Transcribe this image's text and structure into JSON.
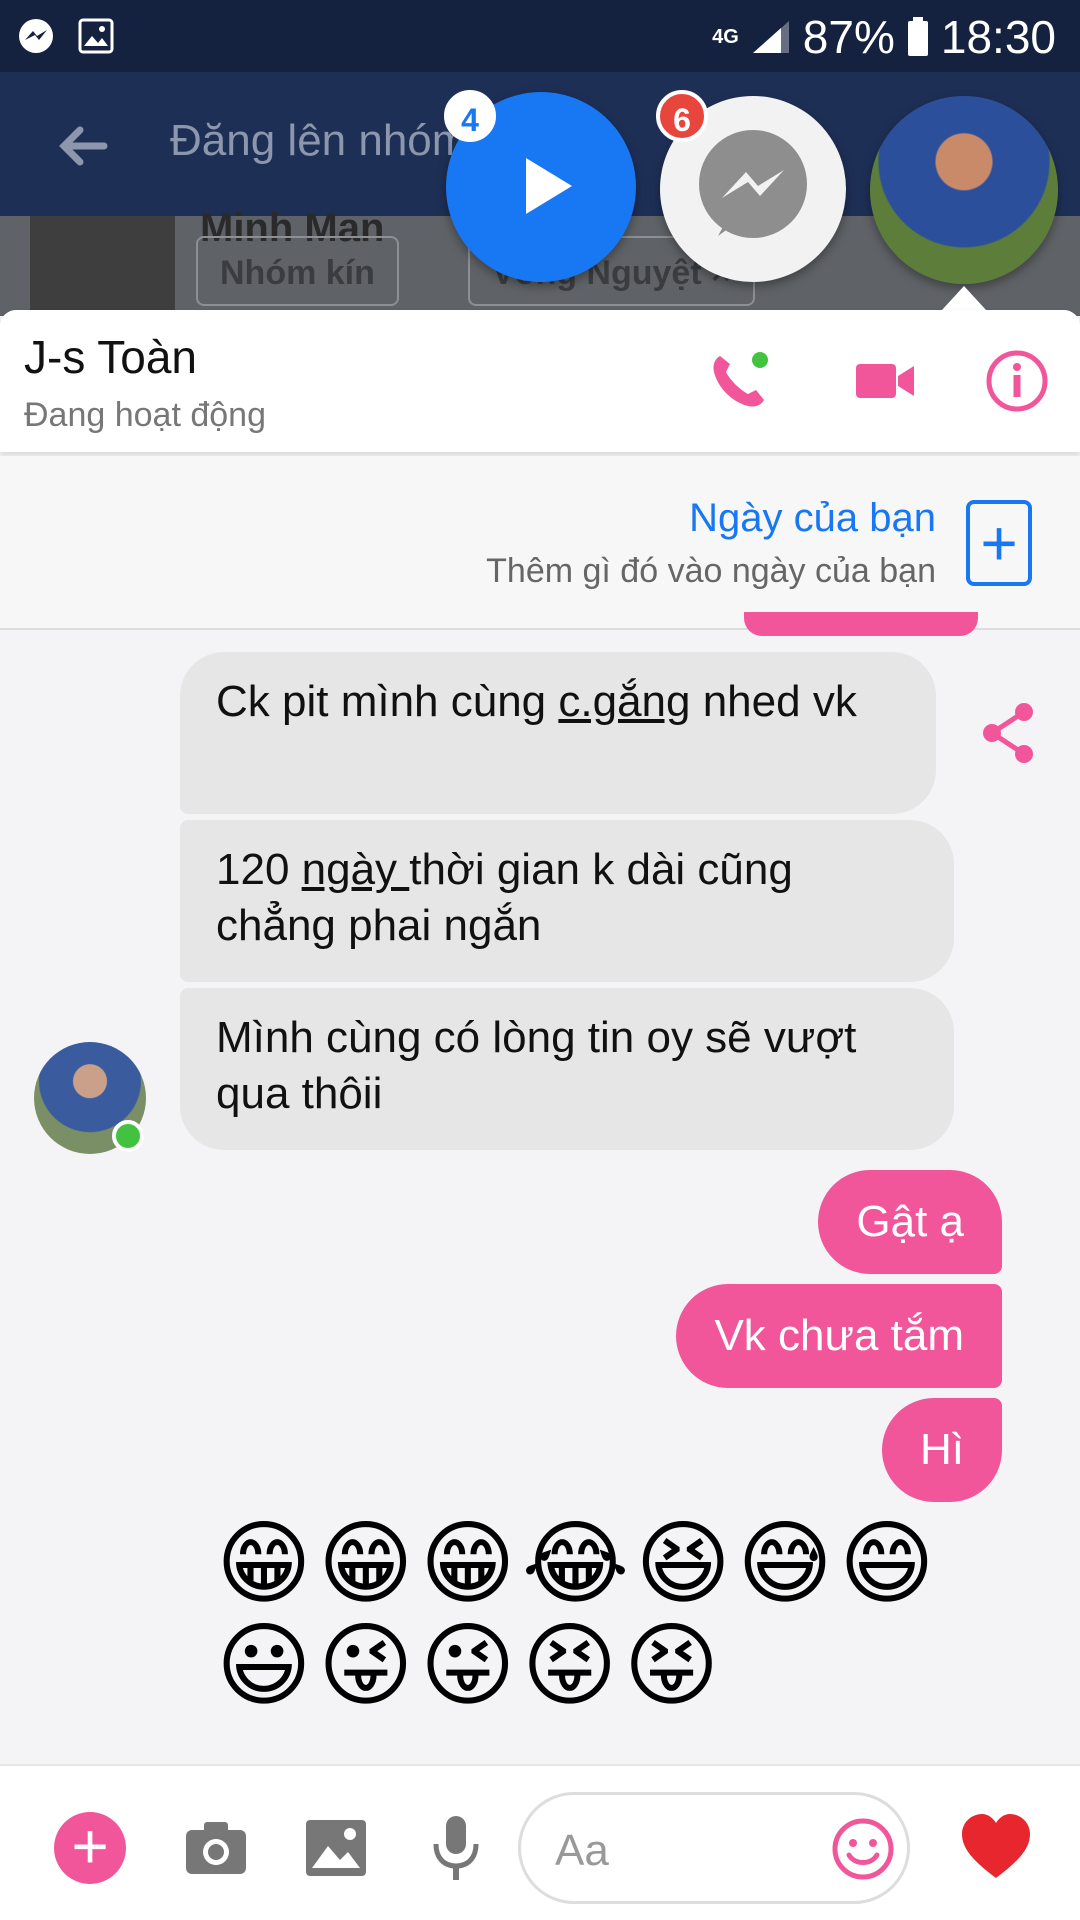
{
  "status_bar": {
    "network": "4G",
    "battery": "87%",
    "time": "18:30"
  },
  "background_app": {
    "title": "Đăng lên nhóm",
    "heading": "Minh Man",
    "tags": [
      "Nhóm kín",
      "Vòng Nguyệt ×"
    ]
  },
  "chat_heads": {
    "video_badge": "4",
    "messenger_badge": "6"
  },
  "chat": {
    "name": "J-s Toàn",
    "status": "Đang hoạt động"
  },
  "your_day": {
    "title": "Ngày của bạn",
    "subtitle": "Thêm gì đó vào ngày của bạn",
    "plus": "+"
  },
  "messages": {
    "in1_a": "Ck pit mình cùng ",
    "in1_b": "c.gắng",
    "in1_c": " nhed vk",
    "in2_a": "120 ",
    "in2_b": "ngày ",
    "in2_c": "thời gian k dài cũng chẳng phai ngắn",
    "in3": "Mình cùng có lòng tin oy sẽ vượt qua thôii",
    "out1": "Gật ạ",
    "out2": "Vk chưa tắm",
    "out3": "Hì",
    "emoji_row1": "😁😁😁😂😆😅😄",
    "emoji_row2": "😃😜😜😝😝"
  },
  "composer": {
    "placeholder": "Aa",
    "plus": "+"
  },
  "colors": {
    "accent": "#f2569a",
    "link": "#1877f2",
    "status_bar": "#14223f"
  }
}
